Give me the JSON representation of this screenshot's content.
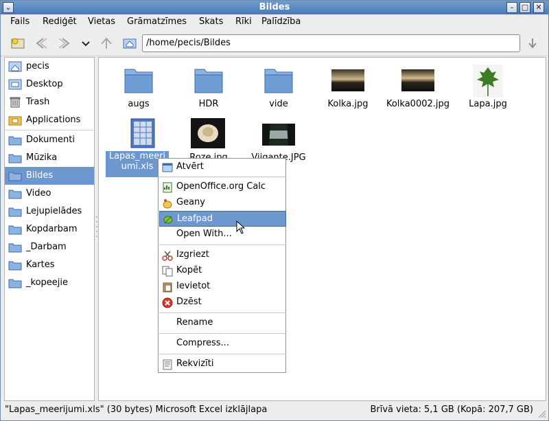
{
  "window": {
    "title": "Bildes"
  },
  "menubar": [
    "Fails",
    "Rediģēt",
    "Vietas",
    "Grāmatzīmes",
    "Skats",
    "Rīki",
    "Palīdzība"
  ],
  "location": {
    "path": "/home/pecis/Bildes"
  },
  "sidebar": {
    "places": [
      {
        "label": "pecis",
        "icon": "home-icon"
      },
      {
        "label": "Desktop",
        "icon": "desktop-icon"
      },
      {
        "label": "Trash",
        "icon": "trash-icon"
      },
      {
        "label": "Applications",
        "icon": "applications-icon"
      }
    ],
    "bookmarks": [
      {
        "label": "Dokumenti"
      },
      {
        "label": "Mūzika"
      },
      {
        "label": "Bildes",
        "selected": true
      },
      {
        "label": "Video"
      },
      {
        "label": "Lejupielādes"
      },
      {
        "label": "Kopdarbam"
      },
      {
        "label": "_Darbam"
      },
      {
        "label": "Kartes"
      },
      {
        "label": "_kopeejie"
      }
    ]
  },
  "files": [
    {
      "name": "augs",
      "type": "folder"
    },
    {
      "name": "HDR",
      "type": "folder"
    },
    {
      "name": "vide",
      "type": "folder"
    },
    {
      "name": "Kolka.jpg",
      "type": "image"
    },
    {
      "name": "Kolka0002.jpg",
      "type": "image"
    },
    {
      "name": "Lapa.jpg",
      "type": "image"
    },
    {
      "name_line1": "Lapas_meeri",
      "name_line2": "umi.xls",
      "type": "spreadsheet",
      "selected": true
    },
    {
      "name": "Roze.jpg",
      "type": "image"
    },
    {
      "name": "Vijgante.JPG",
      "type": "image"
    }
  ],
  "context_menu": {
    "open": "Atvērt",
    "apps": [
      "OpenOffice.org Calc",
      "Geany",
      "Leafpad"
    ],
    "open_with": "Open With...",
    "cut": "Izgriezt",
    "copy": "Kopēt",
    "paste": "Ievietot",
    "delete": "Dzēst",
    "rename": "Rename",
    "compress": "Compress...",
    "properties": "Rekvizīti",
    "hovered": "Leafpad"
  },
  "status": {
    "left": "\"Lapas_meerijumi.xls\" (30 bytes) Microsoft Excel izklājlapa",
    "right": "Brīvā vieta: 5,1 GB (Kopā: 207,7 GB)"
  },
  "colors": {
    "selection": "#6d97cf",
    "titlebar": "#5a88c0"
  }
}
